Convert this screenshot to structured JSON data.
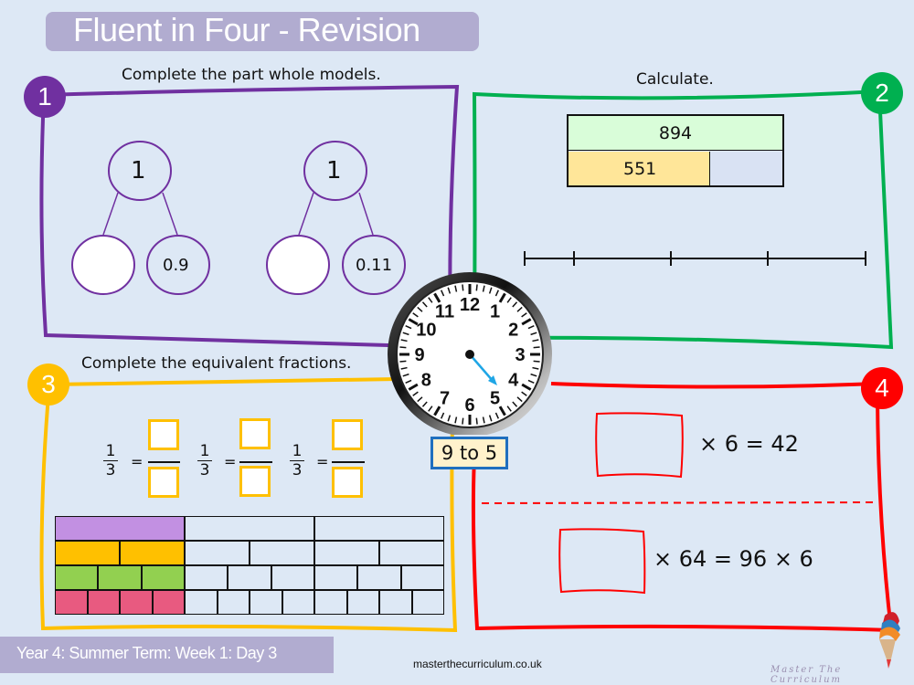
{
  "header": {
    "title": "Fluent in Four - Revision"
  },
  "colors": {
    "background": "#dde8f5",
    "q1": "#7030a0",
    "q2": "#00b050",
    "q3": "#ffc000",
    "q4": "#ff0000",
    "title_bar": "#b1acd0"
  },
  "questions": [
    {
      "number": "1",
      "instruction": "Complete the part whole models.",
      "models": [
        {
          "whole": "1",
          "part_a": "",
          "part_b": "0.9"
        },
        {
          "whole": "1",
          "part_a": "",
          "part_b": "0.11"
        }
      ]
    },
    {
      "number": "2",
      "instruction": "Calculate.",
      "bar_model": {
        "whole": "894",
        "part_known": "551",
        "part_unknown": ""
      },
      "number_line": {
        "ticks": 5
      }
    },
    {
      "number": "3",
      "instruction": "Complete the equivalent fractions.",
      "fractions": [
        {
          "numerator": "1",
          "denominator": "3",
          "equals": "="
        },
        {
          "numerator": "1",
          "denominator": "3",
          "equals": "="
        },
        {
          "numerator": "1",
          "denominator": "3",
          "equals": "="
        }
      ],
      "fraction_wall": {
        "rows": [
          {
            "parts": 3,
            "shaded": 1,
            "color": "#c290e2"
          },
          {
            "parts": 6,
            "shaded": 2,
            "color": "#ffc000"
          },
          {
            "parts": 9,
            "shaded": 3,
            "color": "#92d050"
          },
          {
            "parts": 12,
            "shaded": 4,
            "color": "#e85a80"
          }
        ]
      }
    },
    {
      "number": "4",
      "equations": [
        {
          "text": "× 6 = 42"
        },
        {
          "text": "× 64 = 96 × 6"
        }
      ]
    }
  ],
  "clock": {
    "numerals": [
      "12",
      "1",
      "2",
      "3",
      "4",
      "5",
      "6",
      "7",
      "8",
      "9",
      "10",
      "11"
    ],
    "label": "9 to 5"
  },
  "footer": {
    "lesson": "Year 4: Summer Term: Week 1: Day 3",
    "website": "masterthecurriculum.co.uk",
    "logo_text": "Master The Curriculum"
  }
}
